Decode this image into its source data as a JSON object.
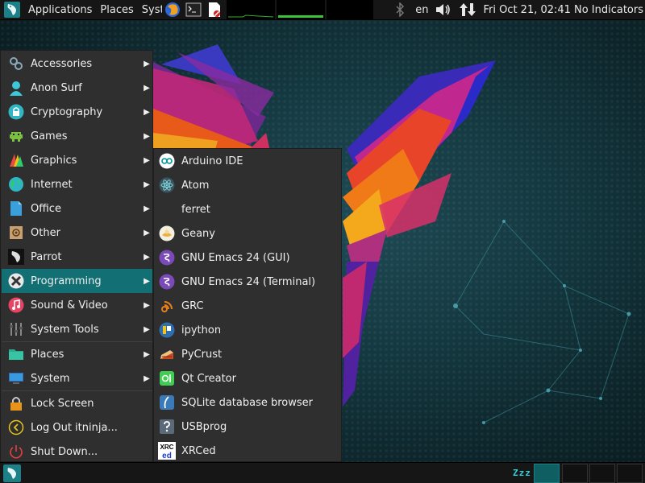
{
  "top_panel": {
    "menus": [
      "Applications",
      "Places",
      "Syst"
    ],
    "keyboard_layout": "en",
    "clock": "Fri Oct 21, 02:41",
    "indicators": "No Indicators"
  },
  "app_menu": {
    "items": [
      {
        "label": "Accessories",
        "icon": "accessories-icon",
        "has_submenu": true
      },
      {
        "label": "Anon Surf",
        "icon": "anonsurf-icon",
        "has_submenu": true
      },
      {
        "label": "Cryptography",
        "icon": "lock-icon",
        "has_submenu": true
      },
      {
        "label": "Games",
        "icon": "games-icon",
        "has_submenu": true
      },
      {
        "label": "Graphics",
        "icon": "graphics-icon",
        "has_submenu": true
      },
      {
        "label": "Internet",
        "icon": "globe-icon",
        "has_submenu": true
      },
      {
        "label": "Office",
        "icon": "document-icon",
        "has_submenu": true
      },
      {
        "label": "Other",
        "icon": "other-icon",
        "has_submenu": true
      },
      {
        "label": "Parrot",
        "icon": "parrot-icon",
        "has_submenu": true
      },
      {
        "label": "Programming",
        "icon": "programming-icon",
        "has_submenu": true,
        "active": true
      },
      {
        "label": "Sound & Video",
        "icon": "music-icon",
        "has_submenu": true
      },
      {
        "label": "System Tools",
        "icon": "system-tools-icon",
        "has_submenu": true
      },
      {
        "label": "Places",
        "icon": "folder-icon",
        "has_submenu": true
      },
      {
        "label": "System",
        "icon": "monitor-icon",
        "has_submenu": true
      },
      {
        "label": "Lock Screen",
        "icon": "padlock-icon",
        "has_submenu": false
      },
      {
        "label": "Log Out itninja...",
        "icon": "logout-icon",
        "has_submenu": false
      },
      {
        "label": "Shut Down...",
        "icon": "power-icon",
        "has_submenu": false
      }
    ]
  },
  "programming_menu": {
    "items": [
      {
        "label": "Arduino IDE",
        "icon": "arduino-icon"
      },
      {
        "label": "Atom",
        "icon": "atom-icon"
      },
      {
        "label": "ferret",
        "icon": "blank-icon"
      },
      {
        "label": "Geany",
        "icon": "geany-icon"
      },
      {
        "label": "GNU Emacs 24 (GUI)",
        "icon": "emacs-icon"
      },
      {
        "label": "GNU Emacs 24 (Terminal)",
        "icon": "emacs-icon"
      },
      {
        "label": "GRC",
        "icon": "grc-icon"
      },
      {
        "label": "ipython",
        "icon": "ipython-icon"
      },
      {
        "label": "PyCrust",
        "icon": "pycrust-icon"
      },
      {
        "label": "Qt Creator",
        "icon": "qt-icon"
      },
      {
        "label": "SQLite database browser",
        "icon": "sqlite-icon"
      },
      {
        "label": "USBprog",
        "icon": "help-icon"
      },
      {
        "label": "XRCed",
        "icon": "xrced-icon"
      }
    ],
    "xrced_icon_text": [
      "XRC",
      "ed"
    ]
  },
  "bottom_panel": {
    "sleep_indicator": "Zzz"
  },
  "colors": {
    "panel_bg": "#161616",
    "menu_bg": "#2f2f2f",
    "menu_highlight": "#126f74",
    "accent": "#1b9aa3"
  }
}
